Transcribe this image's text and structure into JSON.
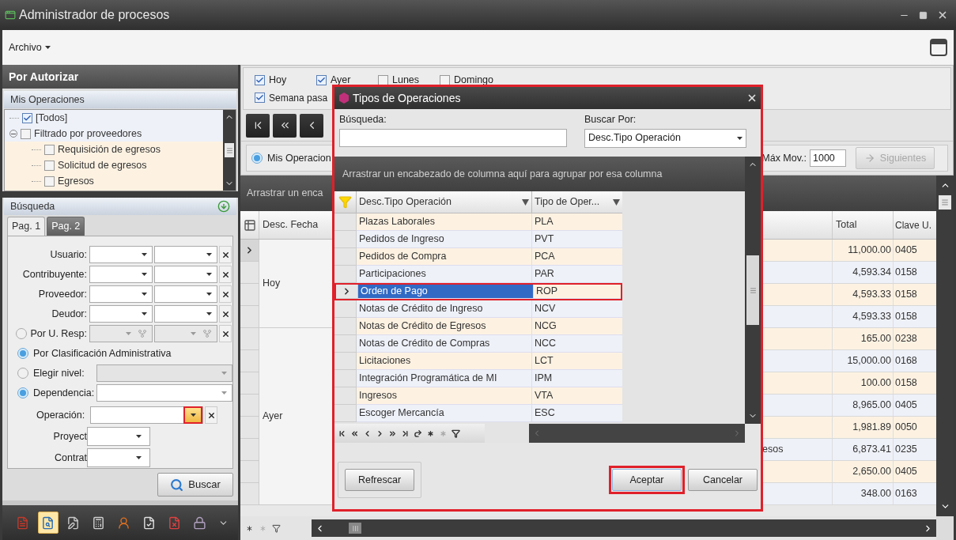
{
  "window": {
    "title": "Administrador de procesos"
  },
  "menu": [
    {
      "label": "Archivo"
    }
  ],
  "left_panel": {
    "title": "Por Autorizar",
    "section": "Mis Operaciones",
    "tree": [
      {
        "label": "[Todos]",
        "checked": true
      },
      {
        "label": "Filtrado por proveedores",
        "checked": false,
        "expanded": true,
        "children": [
          {
            "label": "Requisición de egresos",
            "checked": false
          },
          {
            "label": "Solicitud de egresos",
            "checked": false
          },
          {
            "label": "Egresos",
            "checked": false
          }
        ]
      }
    ],
    "search": {
      "title": "Búsqueda",
      "tabs": [
        {
          "label": "Pag. 1",
          "selected": true
        },
        {
          "label": "Pag. 2",
          "selected": false
        }
      ],
      "fields": [
        {
          "kind": "double",
          "label": "Usuario:"
        },
        {
          "kind": "double",
          "label": "Contribuyente:"
        },
        {
          "kind": "double",
          "label": "Proveedor:"
        },
        {
          "kind": "double",
          "label": "Deudor:"
        },
        {
          "kind": "radio_double",
          "label": "Por U. Resp:",
          "selected": false,
          "disabled": true
        },
        {
          "kind": "radio",
          "label": "Por Clasificación Administrativa",
          "selected": true
        },
        {
          "kind": "radio_select",
          "label": "Elegir nivel:",
          "selected": false,
          "disabled": true
        },
        {
          "kind": "radio_select",
          "label": "Dependencia:",
          "selected": true,
          "disabled": false
        },
        {
          "kind": "select",
          "label": "Operación:",
          "highlighted": true
        },
        {
          "kind": "small_select",
          "label": "Proyect"
        },
        {
          "kind": "small_select",
          "label": "Contrat"
        }
      ],
      "button": "Buscar"
    },
    "toolbar": [
      {
        "kind": "report",
        "selected": false
      },
      {
        "kind": "search",
        "selected": true
      },
      {
        "kind": "edit",
        "selected": false
      },
      {
        "kind": "calculator",
        "selected": false
      },
      {
        "kind": "user",
        "selected": false
      },
      {
        "kind": "approve",
        "selected": false
      },
      {
        "kind": "reject",
        "selected": false
      },
      {
        "kind": "lock",
        "selected": false
      }
    ]
  },
  "filters": {
    "checkboxes": [
      {
        "label": "Hoy",
        "checked": true
      },
      {
        "label": "Ayer",
        "checked": true
      },
      {
        "label": "Lunes",
        "checked": false
      },
      {
        "label": "Domingo",
        "checked": false
      }
    ],
    "checkboxes_row2": [
      {
        "label": "Semana pasa",
        "checked": true
      }
    ],
    "radio": {
      "label": "Mis Operacion",
      "selected": true
    },
    "max_label": "Máx Mov.:",
    "max_value": "1000",
    "next_button": {
      "label": "Siguientes",
      "disabled": true
    }
  },
  "grid": {
    "group_panel": "Arrastrar un enca",
    "columns": [
      "Desc. Fecha",
      "Total",
      "Clave U."
    ],
    "groups": [
      {
        "label": "Hoy",
        "rows": [
          {
            "total": "11,000.00",
            "clave": "0405",
            "current": true
          },
          {
            "total": "4,593.34",
            "clave": "0158",
            "current": false
          },
          {
            "total": "4,593.33",
            "clave": "0158",
            "current": false
          },
          {
            "total": "4,593.33",
            "clave": "0158",
            "current": false
          }
        ]
      },
      {
        "label": "Ayer",
        "rows": [
          {
            "total": "165.00",
            "clave": "0238",
            "current": false
          },
          {
            "total": "15,000.00",
            "clave": "0168",
            "current": false
          },
          {
            "total": "100.00",
            "clave": "0158",
            "current": false
          },
          {
            "total": "8,965.00",
            "clave": "0405",
            "current": false
          },
          {
            "total": "1,981.89",
            "clave": "0050",
            "current": false
          },
          {
            "column_3": "esos",
            "total": "6,873.41",
            "clave": "0235",
            "current": false
          },
          {
            "total": "2,650.00",
            "clave": "0405",
            "current": false
          },
          {
            "total": "348.00",
            "clave": "0163",
            "current": false
          }
        ]
      }
    ]
  },
  "dialog": {
    "title": "Tipos de Operaciones",
    "search_label": "Búsqueda:",
    "search_by_label": "Buscar Por:",
    "search_by_value": "Desc.Tipo Operación",
    "group_panel": "Arrastrar un encabezado de columna aquí para agrupar por esa columna",
    "columns": [
      "Desc.Tipo Operación",
      "Tipo de Oper..."
    ],
    "rows": [
      {
        "desc": "Plazas Laborales",
        "code": "PLA",
        "selected": false
      },
      {
        "desc": "Pedidos de Ingreso",
        "code": "PVT",
        "selected": false
      },
      {
        "desc": "Pedidos de Compra",
        "code": "PCA",
        "selected": false
      },
      {
        "desc": "Participaciones",
        "code": "PAR",
        "selected": false
      },
      {
        "desc": "Orden de Pago",
        "code": "ROP",
        "selected": true
      },
      {
        "desc": "Notas de Crédito de Ingreso",
        "code": "NCV",
        "selected": false
      },
      {
        "desc": "Notas de Crédito de Egresos",
        "code": "NCG",
        "selected": false
      },
      {
        "desc": "Notas de Crédito de Compras",
        "code": "NCC",
        "selected": false
      },
      {
        "desc": "Licitaciones",
        "code": "LCT",
        "selected": false
      },
      {
        "desc": "Integración Programática de MI",
        "code": "IPM",
        "selected": false
      },
      {
        "desc": "Ingresos",
        "code": "VTA",
        "selected": false
      },
      {
        "desc": "Escoger Mercancía",
        "code": "ESC",
        "selected": false
      }
    ],
    "buttons": [
      {
        "kind": "refresh",
        "label": "Refrescar",
        "highlighted": false
      },
      {
        "kind": "accept",
        "label": "Aceptar",
        "highlighted": true
      },
      {
        "kind": "cancel",
        "label": "Cancelar",
        "highlighted": false
      }
    ]
  }
}
